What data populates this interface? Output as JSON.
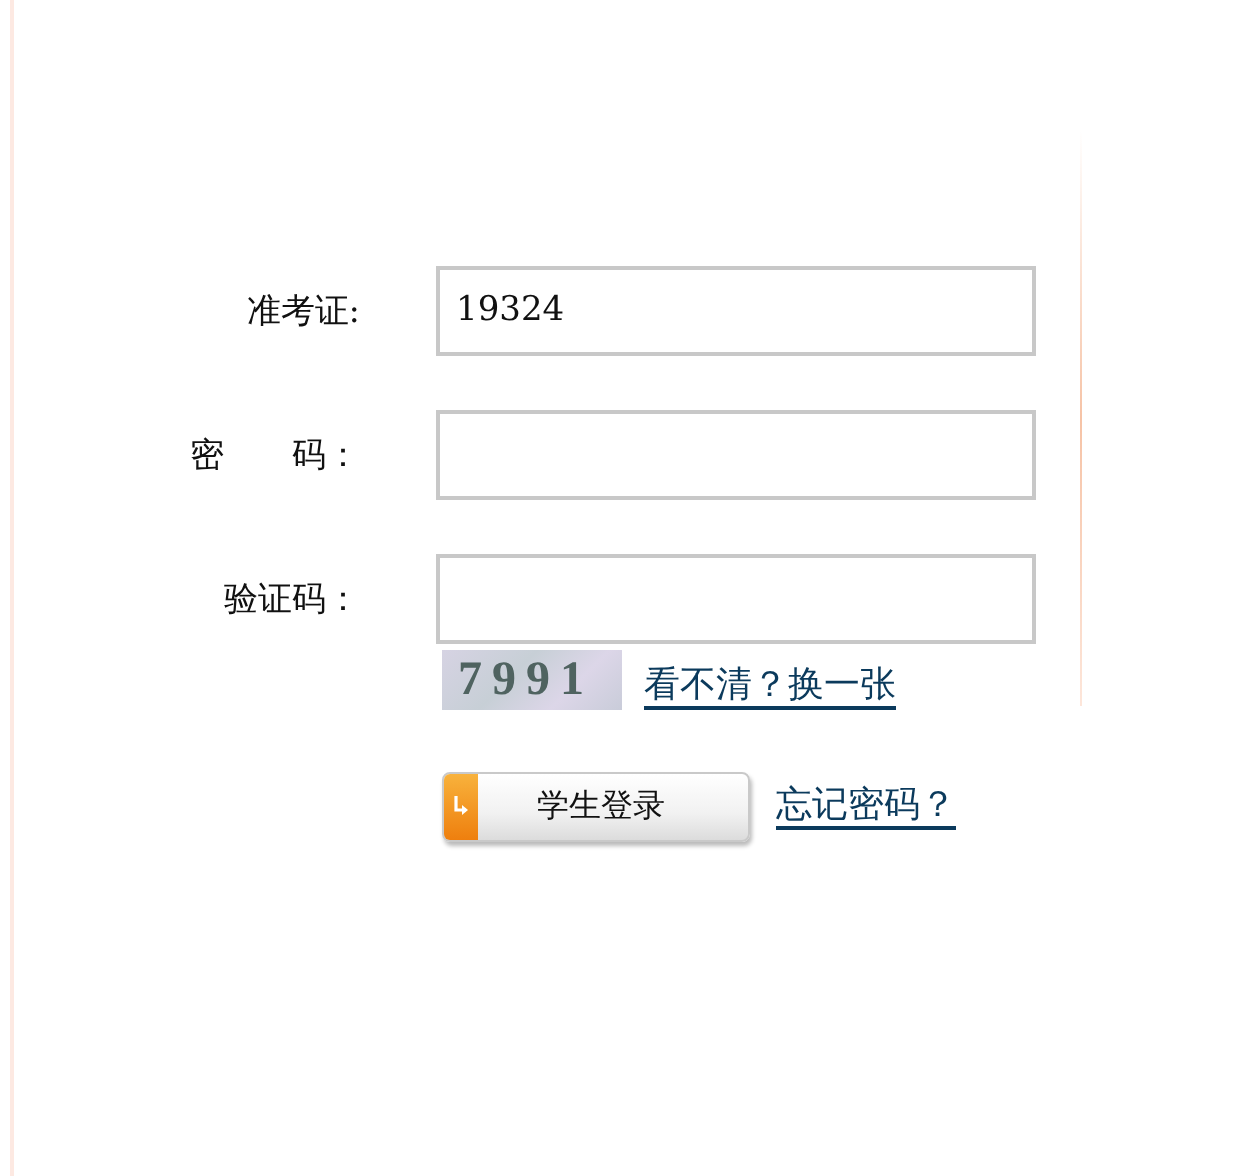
{
  "fields": [
    {
      "label": "准考证:",
      "value": "19324"
    },
    {
      "label": "密　　码："
    },
    {
      "label": "验证码："
    }
  ],
  "captcha": {
    "code": "7991",
    "refresh_link": "看不清？换一张"
  },
  "login_button": "学生登录",
  "forgot_link": "忘记密码？"
}
